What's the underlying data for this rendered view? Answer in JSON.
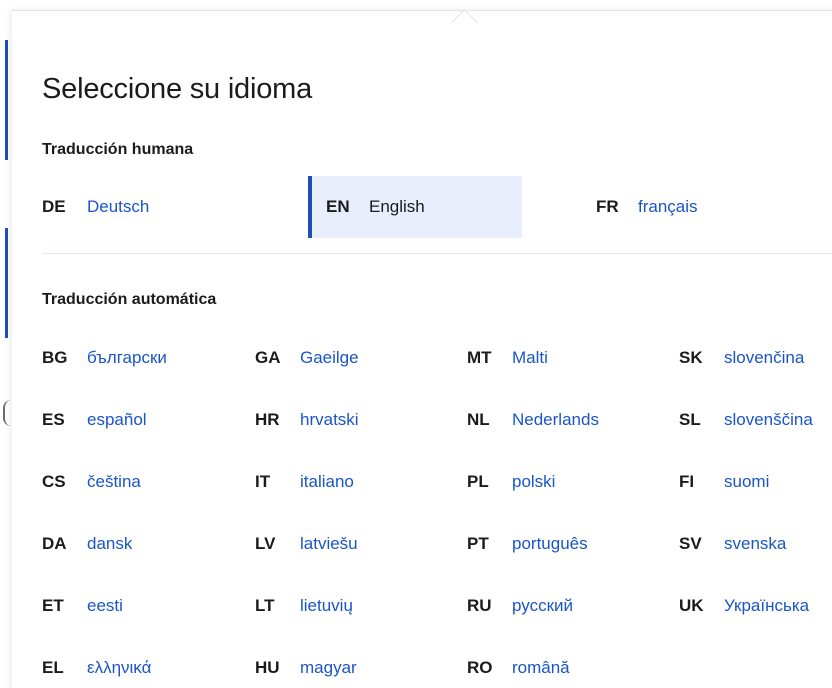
{
  "panel": {
    "title": "Seleccione su idioma"
  },
  "human": {
    "heading": "Traducción humana",
    "languages": [
      {
        "code": "DE",
        "name": "Deutsch",
        "selected": false
      },
      {
        "code": "EN",
        "name": "English",
        "selected": true
      },
      {
        "code": "FR",
        "name": "français",
        "selected": false
      }
    ]
  },
  "machine": {
    "heading": "Traducción automática",
    "columns": [
      [
        {
          "code": "BG",
          "name": "български"
        },
        {
          "code": "ES",
          "name": "español"
        },
        {
          "code": "CS",
          "name": "čeština"
        },
        {
          "code": "DA",
          "name": "dansk"
        },
        {
          "code": "ET",
          "name": "eesti"
        },
        {
          "code": "EL",
          "name": "ελληνικά"
        }
      ],
      [
        {
          "code": "GA",
          "name": "Gaeilge"
        },
        {
          "code": "HR",
          "name": "hrvatski"
        },
        {
          "code": "IT",
          "name": "italiano"
        },
        {
          "code": "LV",
          "name": "latviešu"
        },
        {
          "code": "LT",
          "name": "lietuvių"
        },
        {
          "code": "HU",
          "name": "magyar"
        }
      ],
      [
        {
          "code": "MT",
          "name": "Malti"
        },
        {
          "code": "NL",
          "name": "Nederlands"
        },
        {
          "code": "PL",
          "name": "polski"
        },
        {
          "code": "PT",
          "name": "português"
        },
        {
          "code": "RU",
          "name": "русский"
        },
        {
          "code": "RO",
          "name": "română"
        }
      ],
      [
        {
          "code": "SK",
          "name": "slovenčina"
        },
        {
          "code": "SL",
          "name": "slovenščina"
        },
        {
          "code": "FI",
          "name": "suomi"
        },
        {
          "code": "SV",
          "name": "svenska"
        },
        {
          "code": "UK",
          "name": "Українська"
        }
      ]
    ]
  },
  "colors": {
    "link": "#1a55c7",
    "accent": "#1f4fb4",
    "selected_bg": "#e8eefb",
    "text": "#1b1b1b"
  }
}
